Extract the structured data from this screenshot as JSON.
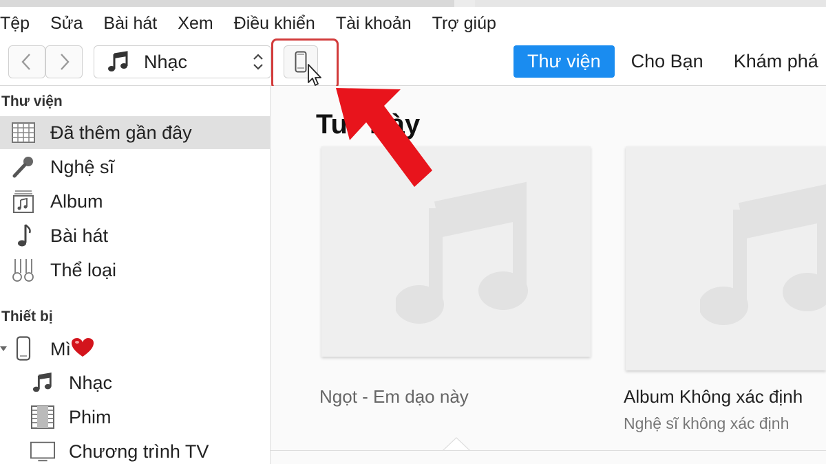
{
  "menubar": {
    "items": [
      "Tệp",
      "Sửa",
      "Bài hát",
      "Xem",
      "Điều khiển",
      "Tài khoản",
      "Trợ giúp"
    ]
  },
  "toolbar": {
    "source_label": "Nhạc"
  },
  "tabs": [
    {
      "label": "Thư viện",
      "active": true
    },
    {
      "label": "Cho Bạn",
      "active": false
    },
    {
      "label": "Khám phá",
      "active": false
    }
  ],
  "sidebar": {
    "library_title": "Thư viện",
    "library_items": [
      {
        "label": "Đã thêm gần đây",
        "icon": "grid-icon",
        "selected": true
      },
      {
        "label": "Nghệ sĩ",
        "icon": "microphone-icon",
        "selected": false
      },
      {
        "label": "Album",
        "icon": "album-icon",
        "selected": false
      },
      {
        "label": "Bài hát",
        "icon": "music-note-icon",
        "selected": false
      },
      {
        "label": "Thể loại",
        "icon": "genres-icon",
        "selected": false
      }
    ],
    "devices_title": "Thiết bị",
    "device_name": "Mì",
    "device_items": [
      {
        "label": "Nhạc",
        "icon": "music-notes-icon"
      },
      {
        "label": "Phim",
        "icon": "film-icon"
      },
      {
        "label": "Chương trình TV",
        "icon": "tv-icon"
      }
    ]
  },
  "main": {
    "heading_left": "Tu",
    "heading_right": "Này",
    "albums": [
      {
        "title": "Ngọt - Em dạo này",
        "artist": ""
      },
      {
        "title": "Album Không xác định",
        "artist": "Nghệ sĩ không xác định"
      }
    ]
  },
  "colors": {
    "accent": "#1a8cf0",
    "highlight_box": "#d23b3b",
    "arrow": "#e8141c"
  }
}
